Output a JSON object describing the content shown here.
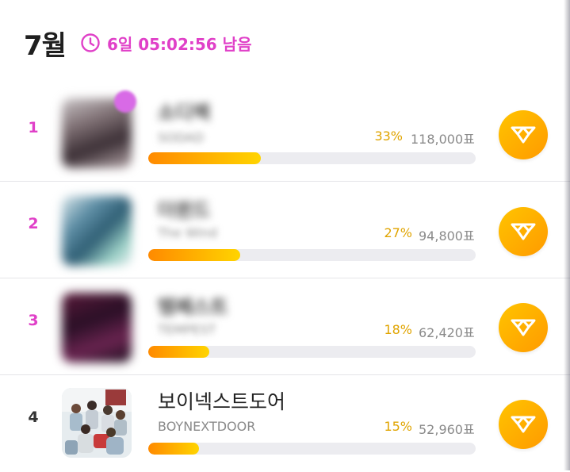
{
  "header": {
    "month": "7월",
    "countdown": "6일 05:02:56 남음"
  },
  "colors": {
    "accent_pink": "#e040c8",
    "percent_gold": "#e0a400",
    "bar_start": "#ff8a00",
    "bar_end": "#ffd400",
    "vote_button": "#ffb300"
  },
  "rows": [
    {
      "rank": "1",
      "name": "소디렉",
      "english_name": "SODAD",
      "percent": "33%",
      "votes": "118,000표",
      "fill_percent": 33,
      "blurred": true
    },
    {
      "rank": "2",
      "name": "더윈드",
      "english_name": "The Wind",
      "percent": "27%",
      "votes": "94,800표",
      "fill_percent": 27,
      "blurred": true
    },
    {
      "rank": "3",
      "name": "템페스트",
      "english_name": "TEMPEST",
      "percent": "18%",
      "votes": "62,420표",
      "fill_percent": 18,
      "blurred": true
    },
    {
      "rank": "4",
      "name": "보이넥스트도어",
      "english_name": "BOYNEXTDOOR",
      "percent": "15%",
      "votes": "52,960표",
      "fill_percent": 15,
      "blurred": false
    }
  ],
  "icons": {
    "timer": "clock-icon",
    "vote": "heart-vote-icon",
    "badge": "pick-badge-icon"
  }
}
